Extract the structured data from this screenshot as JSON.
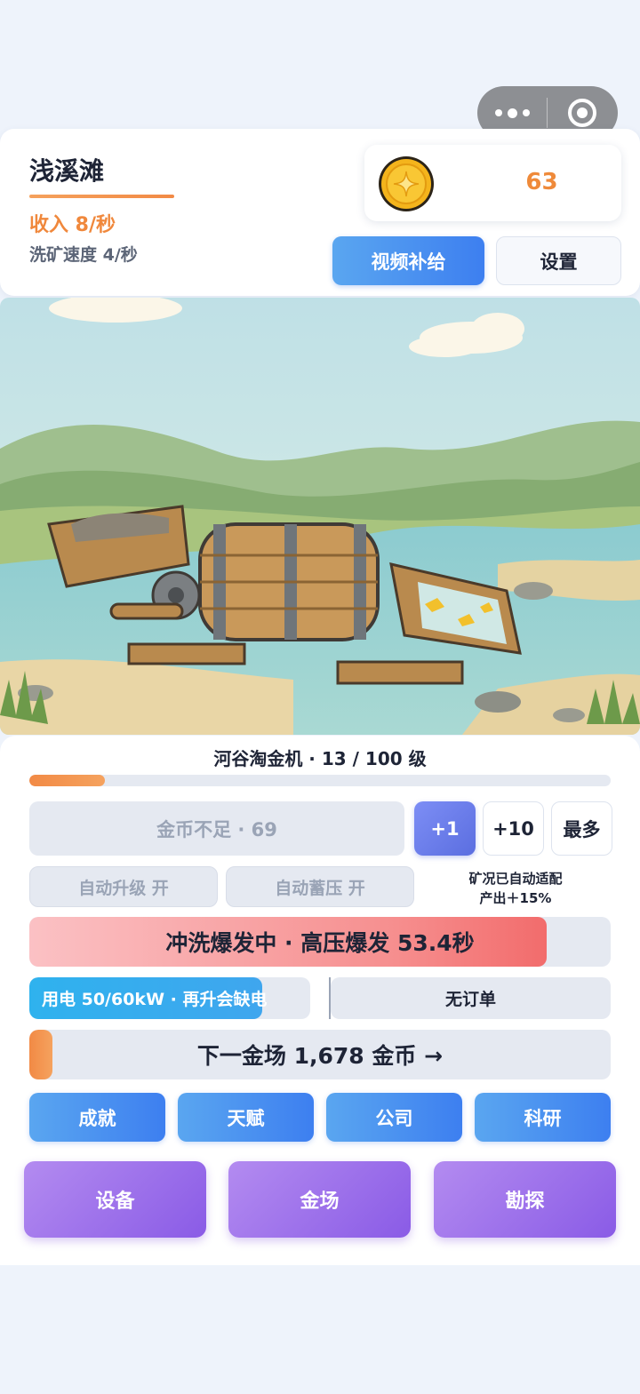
{
  "header": {
    "location": "浅溪滩",
    "income": "收入 8/秒",
    "wash_speed": "洗矿速度 4/秒",
    "coins": "63",
    "video_button": "视频补给",
    "settings_button": "设置"
  },
  "machine": {
    "title": "河谷淘金机 · 13 / 100 级",
    "level_progress": 0.13
  },
  "upgrade": {
    "cost_label": "金币不足 · 69",
    "amount_options": [
      "+1",
      "+10",
      "最多"
    ],
    "selected_amount": "+1"
  },
  "toggles": {
    "auto_upgrade": "自动升级 开",
    "auto_pressure": "自动蓄压 开"
  },
  "adapt_note": {
    "line1": "矿况已自动适配",
    "line2": "产出＋15%"
  },
  "burst": {
    "label": "冲洗爆发中 · 高压爆发 53.4秒",
    "progress": 0.89
  },
  "power": {
    "label": "用电 50/60kW · 再升会缺电",
    "progress": 0.83
  },
  "order": {
    "label": "无订单"
  },
  "next_mine": {
    "label": "下一金场 1,678 金币 →",
    "progress": 0.04
  },
  "nav_blue": [
    "成就",
    "天赋",
    "公司",
    "科研"
  ],
  "nav_purple": [
    "设备",
    "金场",
    "勘探"
  ],
  "colors": {
    "orange_accent": "#f0883c",
    "blue_button": "#3d7ff0",
    "purple_button": "#8a5be6",
    "burst_red": "#f26c6c",
    "power_blue": "#2fb2ee"
  }
}
